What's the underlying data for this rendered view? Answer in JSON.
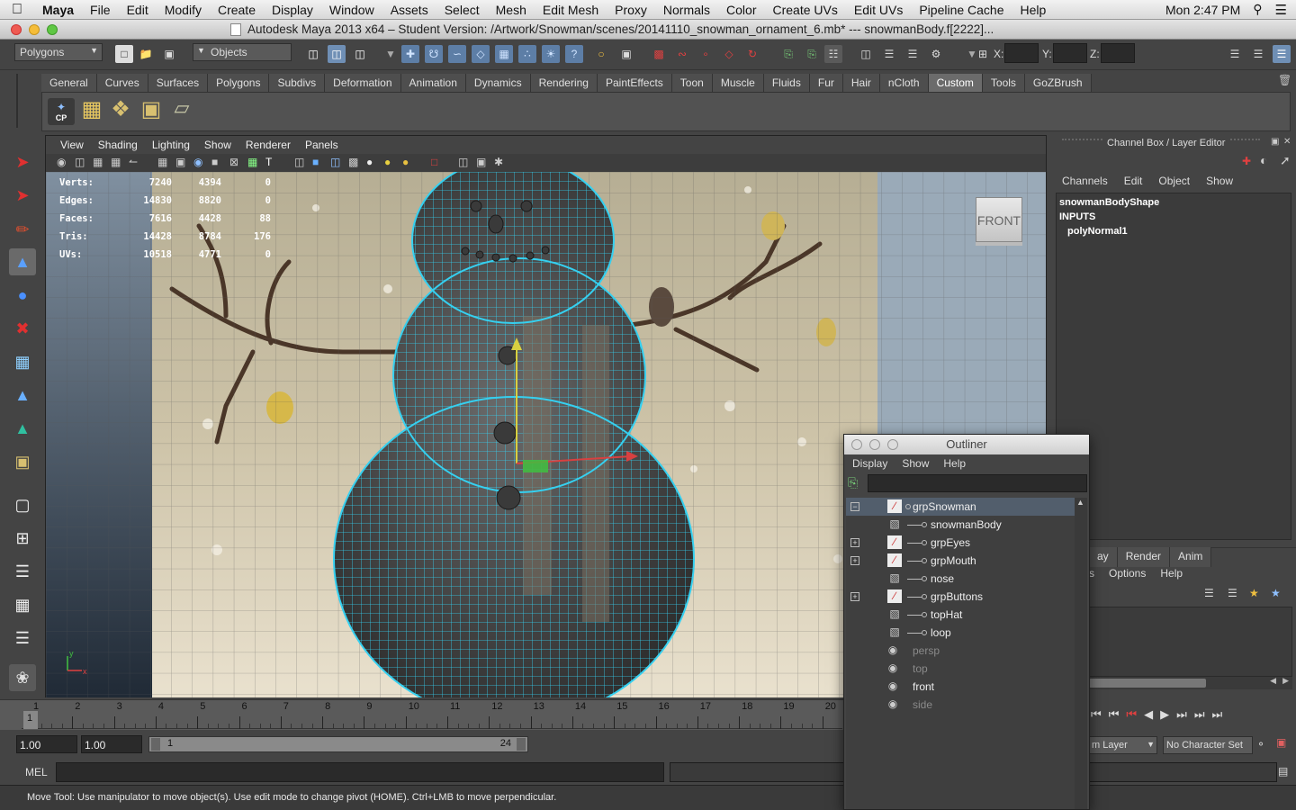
{
  "menubar": {
    "app": "Maya",
    "items": [
      "File",
      "Edit",
      "Modify",
      "Create",
      "Display",
      "Window",
      "Assets",
      "Select",
      "Mesh",
      "Edit Mesh",
      "Proxy",
      "Normals",
      "Color",
      "Create UVs",
      "Edit UVs",
      "Pipeline Cache",
      "Help"
    ],
    "clock": "Mon 2:47 PM"
  },
  "titlebar": {
    "title": "Autodesk Maya 2013 x64 – Student Version: /Artwork/Snowman/scenes/20141110_snowman_ornament_6.mb*   ---   snowmanBody.f[2222]..."
  },
  "statusline": {
    "menuset": "Polygons",
    "selmask": "Objects",
    "x_label": "X:",
    "y_label": "Y:",
    "z_label": "Z:"
  },
  "shelf": {
    "tabs": [
      "General",
      "Curves",
      "Surfaces",
      "Polygons",
      "Subdivs",
      "Deformation",
      "Animation",
      "Dynamics",
      "Rendering",
      "PaintEffects",
      "Toon",
      "Muscle",
      "Fluids",
      "Fur",
      "Hair",
      "nCloth",
      "Custom",
      "Tools",
      "GoZBrush"
    ],
    "active_tab": "Custom",
    "cp_label": "CP"
  },
  "viewport": {
    "menu": [
      "View",
      "Shading",
      "Lighting",
      "Show",
      "Renderer",
      "Panels"
    ],
    "cube_label": "FRONT",
    "hud": [
      {
        "label": "Verts:",
        "a": "7240",
        "b": "4394",
        "c": "0"
      },
      {
        "label": "Edges:",
        "a": "14830",
        "b": "8820",
        "c": "0"
      },
      {
        "label": "Faces:",
        "a": "7616",
        "b": "4428",
        "c": "88"
      },
      {
        "label": "Tris:",
        "a": "14428",
        "b": "8784",
        "c": "176"
      },
      {
        "label": "UVs:",
        "a": "10518",
        "b": "4771",
        "c": "0"
      }
    ]
  },
  "channelbox": {
    "title": "Channel Box / Layer Editor",
    "menu": [
      "Channels",
      "Edit",
      "Object",
      "Show"
    ],
    "shape": "snowmanBodyShape",
    "inputs": "INPUTS",
    "node": "polyNormal1",
    "layer_tabs": [
      "ay",
      "Render",
      "Anim"
    ],
    "layer_menu": [
      "s",
      "Options",
      "Help"
    ]
  },
  "timeline": {
    "ticks": [
      "1",
      "2",
      "3",
      "4",
      "5",
      "6",
      "7",
      "8",
      "9",
      "10",
      "11",
      "12",
      "13",
      "14",
      "15",
      "16",
      "17",
      "18",
      "19",
      "20"
    ],
    "current": "1"
  },
  "range": {
    "start": "1.00",
    "playstart": "1.00",
    "range_start": "1",
    "range_end": "24",
    "anim_layer": "m Layer",
    "char_set": "No Character Set"
  },
  "cmd": {
    "label": "MEL"
  },
  "helpline": {
    "text": "Move Tool: Use manipulator to move object(s). Use edit mode to change pivot (HOME).  Ctrl+LMB to move perpendicular."
  },
  "outliner": {
    "title": "Outliner",
    "menu": [
      "Display",
      "Show",
      "Help"
    ],
    "items": [
      {
        "name": "grpSnowman",
        "expand": "minus",
        "sel": true,
        "dim": false,
        "indent": 0
      },
      {
        "name": "snowmanBody",
        "expand": "",
        "sel": false,
        "dim": false,
        "indent": 1
      },
      {
        "name": "grpEyes",
        "expand": "plus",
        "sel": false,
        "dim": false,
        "indent": 1
      },
      {
        "name": "grpMouth",
        "expand": "plus",
        "sel": false,
        "dim": false,
        "indent": 1
      },
      {
        "name": "nose",
        "expand": "",
        "sel": false,
        "dim": false,
        "indent": 1
      },
      {
        "name": "grpButtons",
        "expand": "plus",
        "sel": false,
        "dim": false,
        "indent": 1
      },
      {
        "name": "topHat",
        "expand": "",
        "sel": false,
        "dim": false,
        "indent": 1
      },
      {
        "name": "loop",
        "expand": "",
        "sel": false,
        "dim": false,
        "indent": 1
      },
      {
        "name": "persp",
        "expand": "",
        "sel": false,
        "dim": true,
        "indent": 0
      },
      {
        "name": "top",
        "expand": "",
        "sel": false,
        "dim": true,
        "indent": 0
      },
      {
        "name": "front",
        "expand": "",
        "sel": false,
        "dim": false,
        "indent": 0
      },
      {
        "name": "side",
        "expand": "",
        "sel": false,
        "dim": true,
        "indent": 0
      }
    ]
  }
}
